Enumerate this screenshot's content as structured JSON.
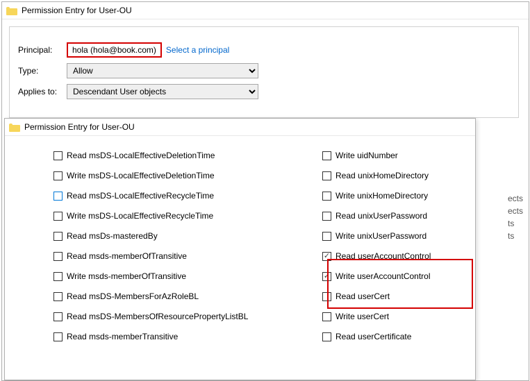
{
  "windowTitle": "Permission Entry for User-OU",
  "labels": {
    "principal": "Principal:",
    "type": "Type:",
    "applies": "Applies to:"
  },
  "principal": "hola (hola@book.com)",
  "selectLink": "Select a principal",
  "typeValue": "Allow",
  "appliesValue": "Descendant User objects",
  "leftPerms": [
    {
      "label": "Read msDS-LocalEffectiveDeletionTime",
      "checked": false,
      "blue": false
    },
    {
      "label": "Write msDS-LocalEffectiveDeletionTime",
      "checked": false,
      "blue": false
    },
    {
      "label": "Read msDS-LocalEffectiveRecycleTime",
      "checked": false,
      "blue": true
    },
    {
      "label": "Write msDS-LocalEffectiveRecycleTime",
      "checked": false,
      "blue": false
    },
    {
      "label": "Read msDs-masteredBy",
      "checked": false,
      "blue": false
    },
    {
      "label": "Read msds-memberOfTransitive",
      "checked": false,
      "blue": false
    },
    {
      "label": "Write msds-memberOfTransitive",
      "checked": false,
      "blue": false
    },
    {
      "label": "Read msDS-MembersForAzRoleBL",
      "checked": false,
      "blue": false
    },
    {
      "label": "Read msDS-MembersOfResourcePropertyListBL",
      "checked": false,
      "blue": false
    },
    {
      "label": "Read msds-memberTransitive",
      "checked": false,
      "blue": false
    }
  ],
  "rightPerms": [
    {
      "label": "Write uidNumber",
      "checked": false
    },
    {
      "label": "Read unixHomeDirectory",
      "checked": false
    },
    {
      "label": "Write unixHomeDirectory",
      "checked": false
    },
    {
      "label": "Read unixUserPassword",
      "checked": false
    },
    {
      "label": "Write unixUserPassword",
      "checked": false
    },
    {
      "label": "Read userAccountControl",
      "checked": true
    },
    {
      "label": "Write userAccountControl",
      "checked": true
    },
    {
      "label": "Read userCert",
      "checked": false
    },
    {
      "label": "Write userCert",
      "checked": false
    },
    {
      "label": "Read userCertificate",
      "checked": false
    }
  ],
  "backList": [
    "ects",
    "ects",
    "ts",
    "ts"
  ]
}
